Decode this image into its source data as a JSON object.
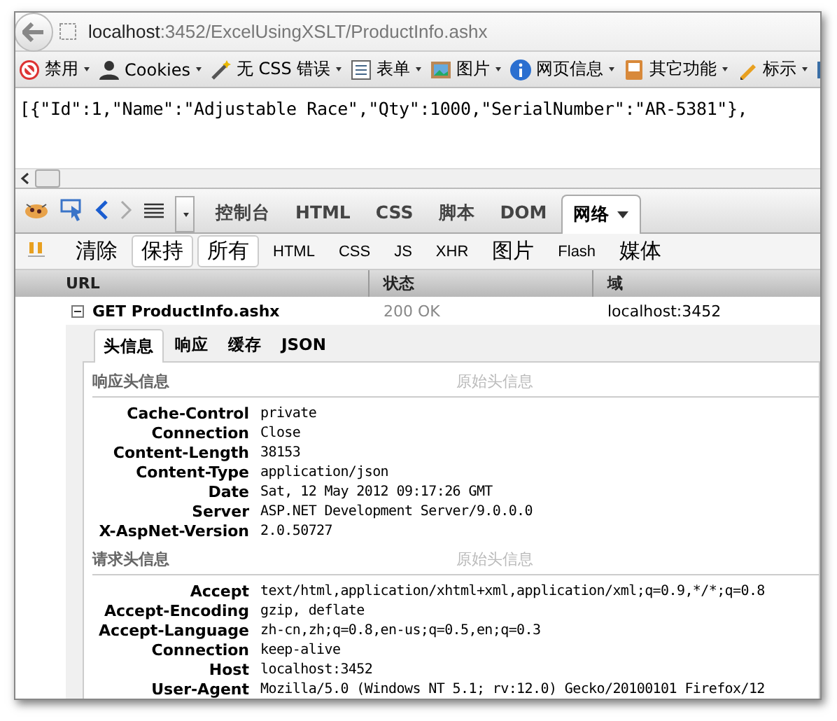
{
  "address_bar": {
    "host": "localhost",
    "path": ":3452/ExcelUsingXSLT/ProductInfo.ashx"
  },
  "toolbar": [
    {
      "kind": "disable",
      "label": "禁用",
      "dropdown": true
    },
    {
      "kind": "person",
      "label": "Cookies",
      "dropdown": true
    },
    {
      "kind": "wand",
      "label": "无 CSS 错误",
      "dropdown": true
    },
    {
      "kind": "form",
      "label": "表单",
      "dropdown": true
    },
    {
      "kind": "image",
      "label": "图片",
      "dropdown": true
    },
    {
      "kind": "info",
      "label": "网页信息",
      "dropdown": true
    },
    {
      "kind": "tray",
      "label": "其它功能",
      "dropdown": true
    },
    {
      "kind": "pencil",
      "label": "标示",
      "dropdown": true
    },
    {
      "kind": "resize",
      "dropdown": false
    }
  ],
  "page_text": "[{\"Id\":1,\"Name\":\"Adjustable Race\",\"Qty\":1000,\"SerialNumber\":\"AR-5381\"},",
  "firebug": {
    "tabs": [
      {
        "label": "控制台",
        "selected": false,
        "dropdown": false
      },
      {
        "label": "HTML",
        "selected": false,
        "dropdown": false
      },
      {
        "label": "CSS",
        "selected": false,
        "dropdown": false
      },
      {
        "label": "脚本",
        "selected": false,
        "dropdown": false
      },
      {
        "label": "DOM",
        "selected": false,
        "dropdown": false
      },
      {
        "label": "网络",
        "selected": true,
        "dropdown": true
      }
    ],
    "filters": [
      {
        "label": "清除",
        "selected": false,
        "large": true
      },
      {
        "label": "保持",
        "selected": true,
        "large": true
      },
      {
        "label": "所有",
        "selected": true,
        "large": true
      },
      {
        "label": "HTML",
        "selected": false,
        "large": false
      },
      {
        "label": "CSS",
        "selected": false,
        "large": false
      },
      {
        "label": "JS",
        "selected": false,
        "large": false
      },
      {
        "label": "XHR",
        "selected": false,
        "large": false
      },
      {
        "label": "图片",
        "selected": false,
        "large": true
      },
      {
        "label": "Flash",
        "selected": false,
        "large": false
      },
      {
        "label": "媒体",
        "selected": false,
        "large": true
      }
    ],
    "columns": [
      "URL",
      "状态",
      "域"
    ],
    "request": {
      "expanded": true,
      "url": "GET ProductInfo.ashx",
      "status": "200 OK",
      "domain": "localhost:3452"
    },
    "detail_tabs": [
      {
        "label": "头信息",
        "selected": true
      },
      {
        "label": "响应",
        "selected": false
      },
      {
        "label": "缓存",
        "selected": false
      },
      {
        "label": "JSON",
        "selected": false
      }
    ],
    "sections": [
      {
        "title": "响应头信息",
        "link": "原始头信息",
        "headers": [
          [
            "Cache-Control",
            "private"
          ],
          [
            "Connection",
            "Close"
          ],
          [
            "Content-Length",
            "38153"
          ],
          [
            "Content-Type",
            "application/json"
          ],
          [
            "Date",
            "Sat, 12 May 2012 09:17:26 GMT"
          ],
          [
            "Server",
            "ASP.NET Development Server/9.0.0.0"
          ],
          [
            "X-AspNet-Version",
            "2.0.50727"
          ]
        ]
      },
      {
        "title": "请求头信息",
        "link": "原始头信息",
        "headers": [
          [
            "Accept",
            "text/html,application/xhtml+xml,application/xml;q=0.9,*/*;q=0.8"
          ],
          [
            "Accept-Encoding",
            "gzip, deflate"
          ],
          [
            "Accept-Language",
            "zh-cn,zh;q=0.8,en-us;q=0.5,en;q=0.3"
          ],
          [
            "Connection",
            "keep-alive"
          ],
          [
            "Host",
            "localhost:3452"
          ],
          [
            "User-Agent",
            "Mozilla/5.0 (Windows NT 5.1; rv:12.0) Gecko/20100101 Firefox/12"
          ]
        ]
      }
    ]
  }
}
